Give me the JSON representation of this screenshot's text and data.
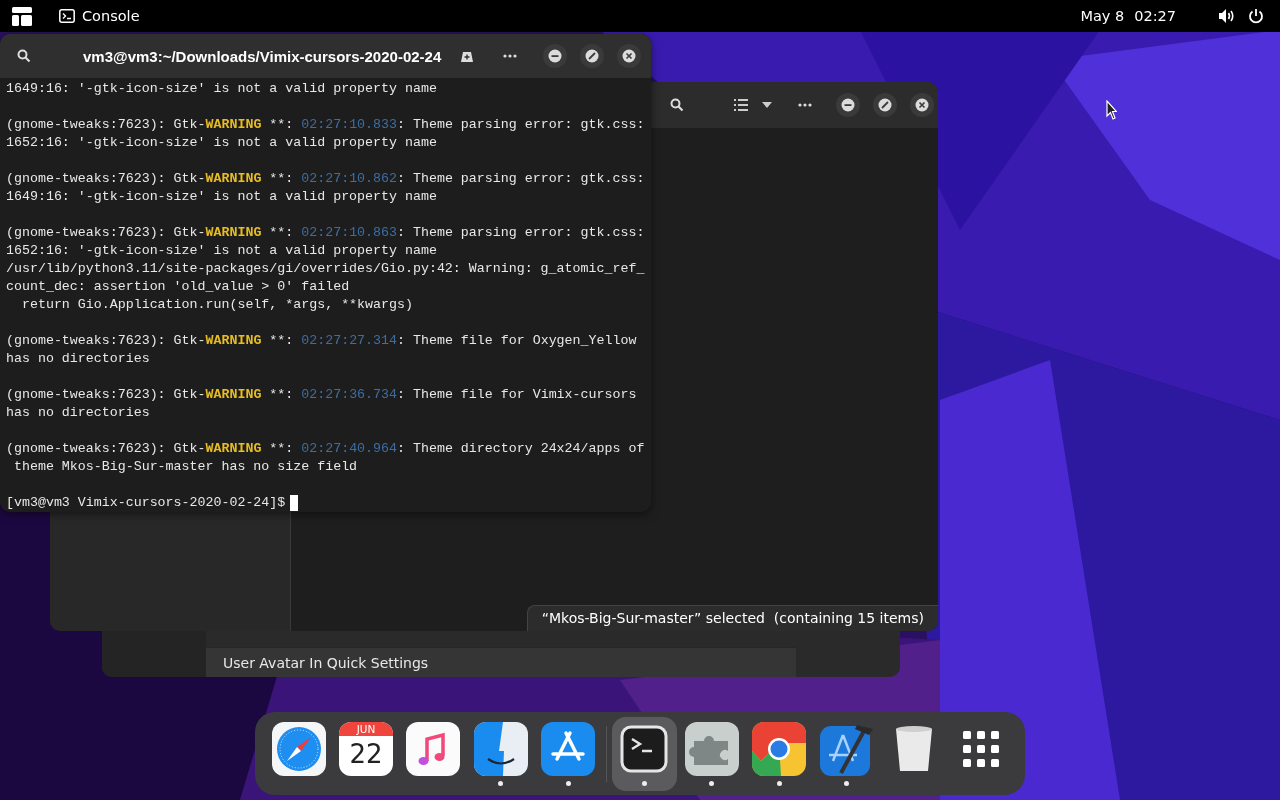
{
  "top_bar": {
    "app_name": "Console",
    "date": "May 8",
    "time": "02:27"
  },
  "back_window": {
    "rows": [
      "User Avatar In Quick Settings"
    ]
  },
  "files_window": {
    "status": "“Mkos-Big-Sur-master” selected  (containing 15 items)"
  },
  "terminal": {
    "title": "vm3@vm3:~/Downloads/Vimix-cursors-2020-02-24",
    "blocks": [
      [
        [
          {
            "kind": "plain",
            "text": "1649:16: '-gtk-icon-size' is not a valid property name"
          }
        ]
      ],
      [
        [
          {
            "kind": "plain",
            "text": "(gnome-tweaks:7623): Gtk-"
          },
          {
            "kind": "warning",
            "text": "WARNING"
          },
          {
            "kind": "plain",
            "text": " **: "
          },
          {
            "kind": "time",
            "text": "02:27:10.833"
          },
          {
            "kind": "plain",
            "text": ": Theme parsing error: gtk.css:"
          }
        ],
        [
          {
            "kind": "plain",
            "text": "1652:16: '-gtk-icon-size' is not a valid property name"
          }
        ]
      ],
      [
        [
          {
            "kind": "plain",
            "text": "(gnome-tweaks:7623): Gtk-"
          },
          {
            "kind": "warning",
            "text": "WARNING"
          },
          {
            "kind": "plain",
            "text": " **: "
          },
          {
            "kind": "time",
            "text": "02:27:10.862"
          },
          {
            "kind": "plain",
            "text": ": Theme parsing error: gtk.css:"
          }
        ],
        [
          {
            "kind": "plain",
            "text": "1649:16: '-gtk-icon-size' is not a valid property name"
          }
        ]
      ],
      [
        [
          {
            "kind": "plain",
            "text": "(gnome-tweaks:7623): Gtk-"
          },
          {
            "kind": "warning",
            "text": "WARNING"
          },
          {
            "kind": "plain",
            "text": " **: "
          },
          {
            "kind": "time",
            "text": "02:27:10.863"
          },
          {
            "kind": "plain",
            "text": ": Theme parsing error: gtk.css:"
          }
        ],
        [
          {
            "kind": "plain",
            "text": "1652:16: '-gtk-icon-size' is not a valid property name"
          }
        ],
        [
          {
            "kind": "plain",
            "text": "/usr/lib/python3.11/site-packages/gi/overrides/Gio.py:42: Warning: g_atomic_ref_"
          }
        ],
        [
          {
            "kind": "plain",
            "text": "count_dec: assertion 'old_value > 0' failed"
          }
        ],
        [
          {
            "kind": "plain",
            "text": "  return Gio.Application.run(self, *args, **kwargs)"
          }
        ]
      ],
      [
        [
          {
            "kind": "plain",
            "text": "(gnome-tweaks:7623): Gtk-"
          },
          {
            "kind": "warning",
            "text": "WARNING"
          },
          {
            "kind": "plain",
            "text": " **: "
          },
          {
            "kind": "time",
            "text": "02:27:27.314"
          },
          {
            "kind": "plain",
            "text": ": Theme file for Oxygen_Yellow"
          }
        ],
        [
          {
            "kind": "plain",
            "text": "has no directories"
          }
        ]
      ],
      [
        [
          {
            "kind": "plain",
            "text": "(gnome-tweaks:7623): Gtk-"
          },
          {
            "kind": "warning",
            "text": "WARNING"
          },
          {
            "kind": "plain",
            "text": " **: "
          },
          {
            "kind": "time",
            "text": "02:27:36.734"
          },
          {
            "kind": "plain",
            "text": ": Theme file for Vimix-cursors"
          }
        ],
        [
          {
            "kind": "plain",
            "text": "has no directories"
          }
        ]
      ],
      [
        [
          {
            "kind": "plain",
            "text": "(gnome-tweaks:7623): Gtk-"
          },
          {
            "kind": "warning",
            "text": "WARNING"
          },
          {
            "kind": "plain",
            "text": " **: "
          },
          {
            "kind": "time",
            "text": "02:27:40.964"
          },
          {
            "kind": "plain",
            "text": ": Theme directory 24x24/apps of"
          }
        ],
        [
          {
            "kind": "plain",
            "text": " theme Mkos-Big-Sur-master has no size field"
          }
        ]
      ]
    ],
    "prompt": "[vm3@vm3 Vimix-cursors-2020-02-24]$"
  },
  "dock": {
    "items": [
      {
        "kind": "compass",
        "running": false,
        "selected": false
      },
      {
        "kind": "calendar",
        "month": "JUN",
        "day": "22",
        "running": false,
        "selected": false
      },
      {
        "kind": "music",
        "running": false,
        "selected": false
      },
      {
        "kind": "face",
        "running": true,
        "selected": false
      },
      {
        "kind": "store",
        "running": true,
        "selected": false
      },
      {
        "kind": "terminal",
        "running": true,
        "selected": true
      },
      {
        "kind": "puzzle",
        "running": true,
        "selected": false
      },
      {
        "kind": "ring",
        "running": true,
        "selected": false
      },
      {
        "kind": "hammer",
        "running": true,
        "selected": false
      },
      {
        "kind": "trash",
        "running": false,
        "selected": false
      },
      {
        "kind": "grid",
        "running": false,
        "selected": false
      }
    ]
  }
}
